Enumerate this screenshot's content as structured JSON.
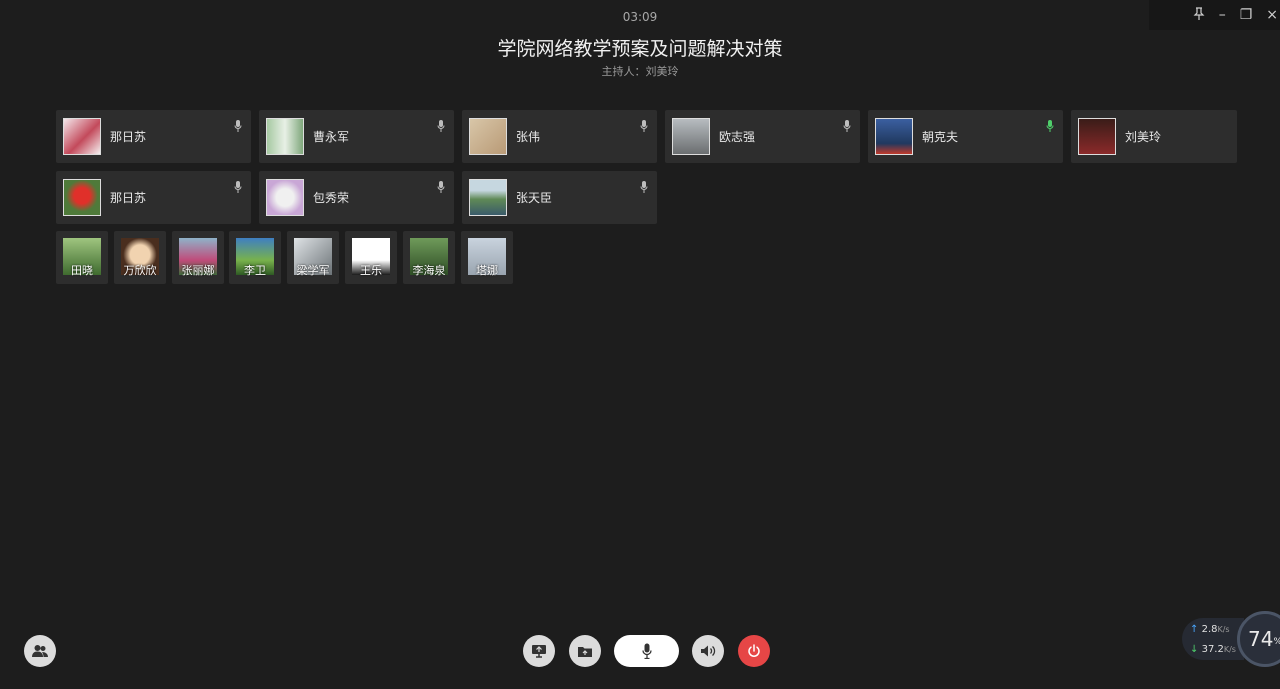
{
  "window": {
    "pin_label": "pin",
    "minimize_label": "–",
    "restore_label": "❐",
    "close_label": "×"
  },
  "meeting": {
    "timer": "03:09",
    "title": "学院网络教学预案及问题解决对策",
    "host": "主持人：刘美玲"
  },
  "speakers": [
    {
      "name": "那日苏",
      "mic_active": false
    },
    {
      "name": "曹永军",
      "mic_active": false
    },
    {
      "name": "张伟",
      "mic_active": false
    },
    {
      "name": "欧志强",
      "mic_active": false
    },
    {
      "name": "朝克夫",
      "mic_active": true
    },
    {
      "name": "刘美玲",
      "mic_active": null
    },
    {
      "name": "那日苏",
      "mic_active": false
    },
    {
      "name": "包秀荣",
      "mic_active": false
    },
    {
      "name": "张天臣",
      "mic_active": false
    }
  ],
  "listeners": [
    {
      "name": "田晓"
    },
    {
      "name": "万欣欣"
    },
    {
      "name": "张丽娜"
    },
    {
      "name": "李卫"
    },
    {
      "name": "梁学军"
    },
    {
      "name": "王乐"
    },
    {
      "name": "李海泉"
    },
    {
      "name": "塔娜"
    }
  ],
  "controls": {
    "participants_icon": "people-icon",
    "share_screen_icon": "screen-share-icon",
    "share_file_icon": "folder-share-icon",
    "mic_icon": "microphone-icon",
    "speaker_icon": "speaker-icon",
    "power_icon": "power-icon"
  },
  "network": {
    "upload": "2.8",
    "upload_unit": "K/s",
    "download": "37.2",
    "download_unit": "K/s",
    "gauge_value": "74",
    "gauge_unit": "%"
  },
  "colors": {
    "background": "#1d1d1d",
    "card": "#2d2d2d",
    "mic_active": "#4fcf6b",
    "power": "#e64646"
  }
}
